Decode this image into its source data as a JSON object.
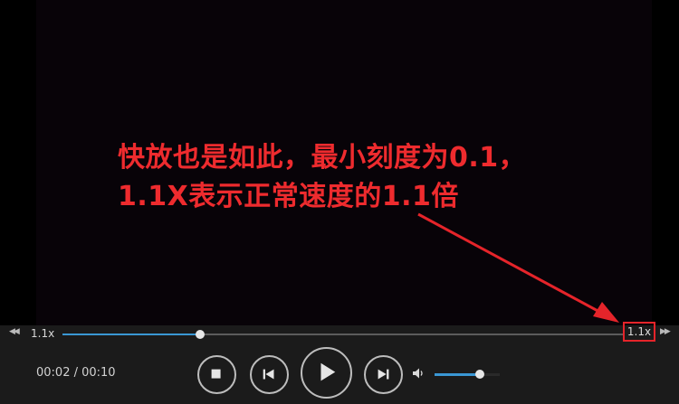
{
  "annotation": {
    "line1": "快放也是如此，最小刻度为0.1，",
    "line2": "1.1X表示正常速度的1.1倍",
    "color": "#ee2b2e"
  },
  "controls": {
    "slow_label": "◀◀",
    "fast_label": "▶▶",
    "speed_left": "1.1x",
    "speed_right": "1.1x",
    "time": "00:02 / 00:10",
    "progress": 0.245,
    "volume": 0.7,
    "accent": "#3a97d4",
    "highlight_color": "#e5242a"
  }
}
